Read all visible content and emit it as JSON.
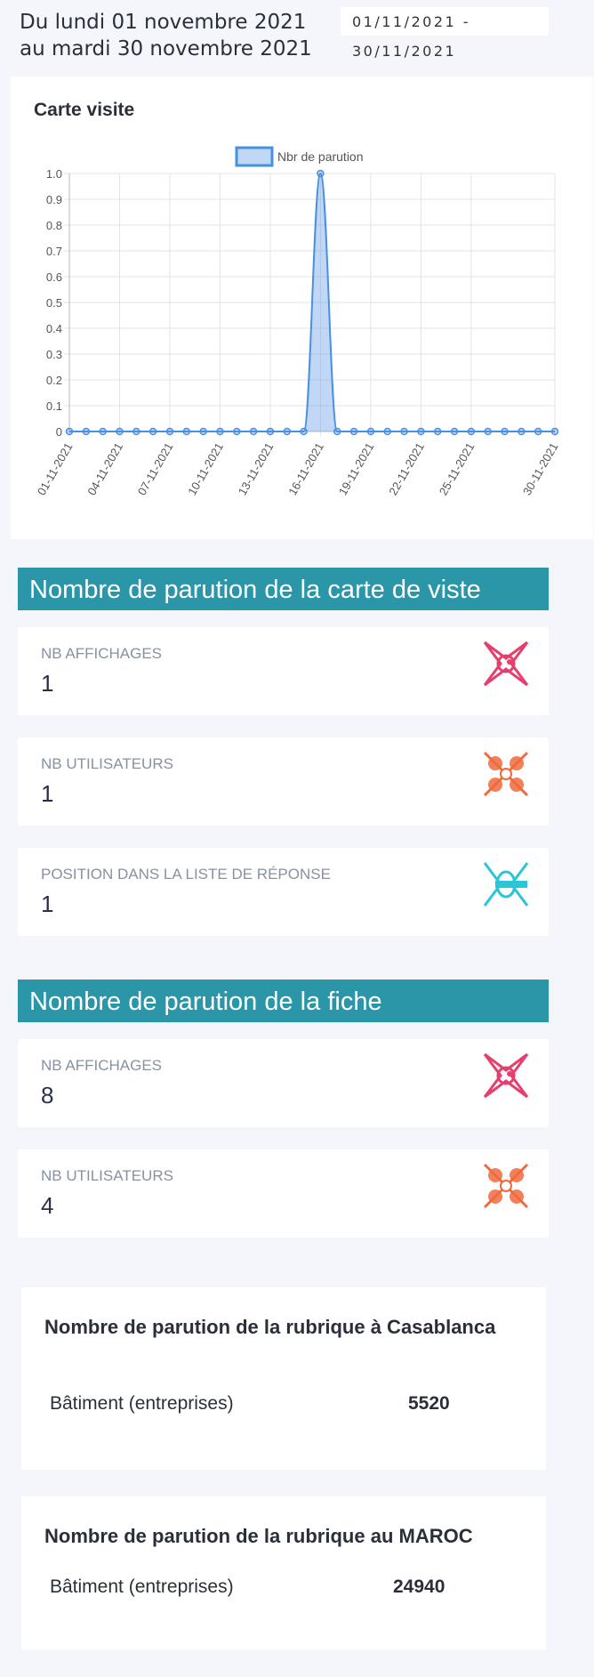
{
  "header": {
    "period_line1": "Du lundi 01 novembre 2021",
    "period_line2": "au mardi 30 novembre 2021",
    "date_input_value": "01/11/2021 -\n30/11/2021"
  },
  "chart_card": {
    "title": "Carte visite"
  },
  "chart_data": {
    "type": "area",
    "title": "Carte visite",
    "series": [
      {
        "name": "Nbr de parution",
        "color": "#4a90e2",
        "values": [
          0,
          0,
          0,
          0,
          0,
          0,
          0,
          0,
          0,
          0,
          0,
          0,
          0,
          0,
          0,
          1,
          0,
          0,
          0,
          0,
          0,
          0,
          0,
          0,
          0,
          0,
          0,
          0,
          0,
          0
        ]
      }
    ],
    "x": [
      "01-11-2021",
      "02-11-2021",
      "03-11-2021",
      "04-11-2021",
      "05-11-2021",
      "06-11-2021",
      "07-11-2021",
      "08-11-2021",
      "09-11-2021",
      "10-11-2021",
      "11-11-2021",
      "12-11-2021",
      "13-11-2021",
      "14-11-2021",
      "15-11-2021",
      "16-11-2021",
      "17-11-2021",
      "18-11-2021",
      "19-11-2021",
      "20-11-2021",
      "21-11-2021",
      "22-11-2021",
      "23-11-2021",
      "24-11-2021",
      "25-11-2021",
      "26-11-2021",
      "27-11-2021",
      "28-11-2021",
      "29-11-2021",
      "30-11-2021"
    ],
    "x_tick_labels": [
      "01-11-2021",
      "04-11-2021",
      "07-11-2021",
      "10-11-2021",
      "13-11-2021",
      "16-11-2021",
      "19-11-2021",
      "22-11-2021",
      "25-11-2021",
      "30-11-2021"
    ],
    "y_tick_labels": [
      "0",
      "0.1",
      "0.2",
      "0.3",
      "0.4",
      "0.5",
      "0.6",
      "0.7",
      "0.8",
      "0.9",
      "1.0"
    ],
    "ylim": [
      0,
      1
    ],
    "grid": true,
    "legend": "top-center"
  },
  "carte_section": {
    "title": "Nombre de parution de la carte de viste",
    "stats": [
      {
        "label": "NB AFFICHAGES",
        "value": "1",
        "icon": "pink-ornament-icon",
        "color": "#e63e6d"
      },
      {
        "label": "NB UTILISATEURS",
        "value": "1",
        "icon": "orange-ornament-icon",
        "color": "#f06a3d"
      },
      {
        "label": "POSITION DANS LA LISTE DE RÉPONSE",
        "value": "1",
        "icon": "cyan-ornament-icon",
        "color": "#2ac6d8"
      }
    ]
  },
  "fiche_section": {
    "title": "Nombre de parution de la fiche",
    "stats": [
      {
        "label": "NB AFFICHAGES",
        "value": "8",
        "icon": "pink-ornament-icon",
        "color": "#e63e6d"
      },
      {
        "label": "NB UTILISATEURS",
        "value": "4",
        "icon": "orange-ornament-icon",
        "color": "#f06a3d"
      }
    ]
  },
  "rubrique_casablanca": {
    "title": "Nombre de parution de la rubrique à Casablanca",
    "row_name": "Bâtiment (entreprises)",
    "row_value": "5520"
  },
  "rubrique_maroc": {
    "title": "Nombre de parution de la rubrique au MAROC",
    "row_name": "Bâtiment (entreprises)",
    "row_value": "24940"
  }
}
